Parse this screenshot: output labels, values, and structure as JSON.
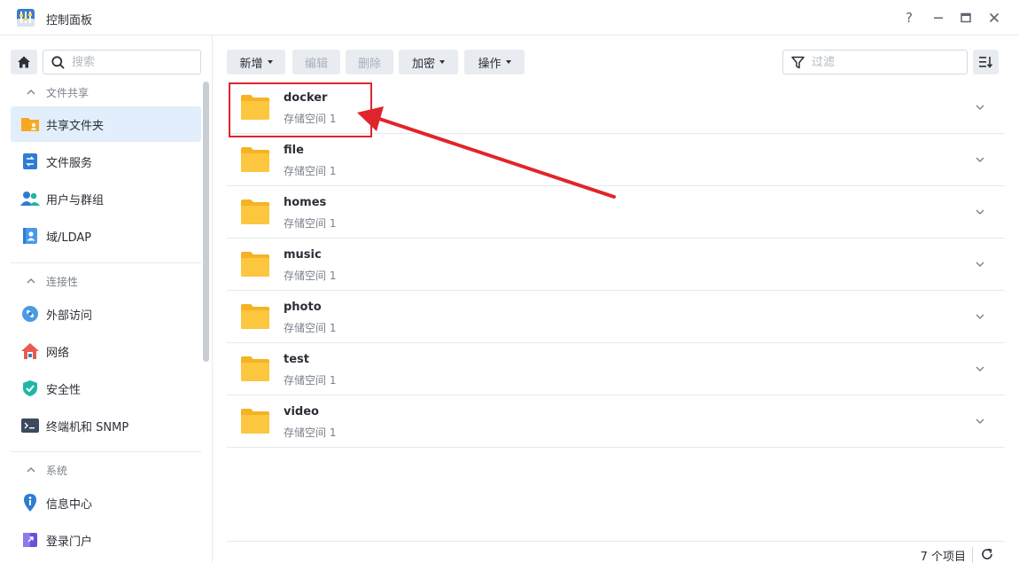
{
  "window": {
    "title": "控制面板",
    "help_symbol": "?",
    "minimize_symbol": "—",
    "close_symbol": "✕"
  },
  "sidebar": {
    "search_placeholder": "搜索",
    "sections": [
      {
        "label": "文件共享",
        "items": [
          {
            "label": "共享文件夹",
            "icon": "shared-folder-icon",
            "active": true
          },
          {
            "label": "文件服务",
            "icon": "file-services-icon"
          },
          {
            "label": "用户与群组",
            "icon": "user-group-icon"
          },
          {
            "label": "域/LDAP",
            "icon": "domain-ldap-icon"
          }
        ]
      },
      {
        "label": "连接性",
        "items": [
          {
            "label": "外部访问",
            "icon": "external-access-icon"
          },
          {
            "label": "网络",
            "icon": "network-icon"
          },
          {
            "label": "安全性",
            "icon": "security-shield-icon"
          },
          {
            "label": "终端机和 SNMP",
            "icon": "terminal-icon"
          }
        ]
      },
      {
        "label": "系统",
        "items": [
          {
            "label": "信息中心",
            "icon": "info-center-icon"
          },
          {
            "label": "登录门户",
            "icon": "login-portal-icon"
          }
        ]
      }
    ]
  },
  "toolbar": {
    "new_label": "新增",
    "edit_label": "编辑",
    "delete_label": "删除",
    "encrypt_label": "加密",
    "action_label": "操作",
    "filter_placeholder": "过滤"
  },
  "folders": [
    {
      "name": "docker",
      "volume": "存储空间 1"
    },
    {
      "name": "file",
      "volume": "存储空间 1"
    },
    {
      "name": "homes",
      "volume": "存储空间 1"
    },
    {
      "name": "music",
      "volume": "存储空间 1"
    },
    {
      "name": "photo",
      "volume": "存储空间 1"
    },
    {
      "name": "test",
      "volume": "存储空间 1"
    },
    {
      "name": "video",
      "volume": "存储空间 1"
    }
  ],
  "footer": {
    "count_text": "7 个项目"
  },
  "colors": {
    "accent_active_bg": "#e2eefb",
    "folder_yellow": "#fcc63f",
    "annotation_red": "#e0242c"
  }
}
